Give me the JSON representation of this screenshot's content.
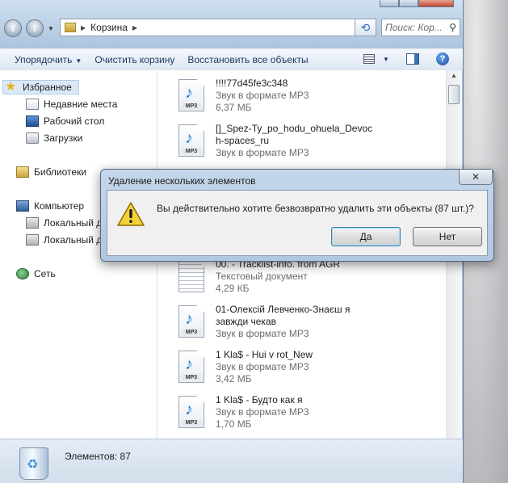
{
  "address": {
    "location": "Корзина",
    "search_placeholder": "Поиск: Кор..."
  },
  "toolbar": {
    "organize": "Упорядочить",
    "empty_bin": "Очистить корзину",
    "restore_all": "Восстановить все объекты"
  },
  "nav": {
    "favorites": "Избранное",
    "recent": "Недавние места",
    "desktop": "Рабочий стол",
    "downloads": "Загрузки",
    "libraries": "Библиотеки",
    "computer": "Компьютер",
    "local_disk_1": "Локальный д",
    "local_disk_2": "Локальный д",
    "network": "Сеть"
  },
  "files": [
    {
      "name": "!!!!77d45fe3c348",
      "type": "Звук в формате MP3",
      "size": "6,37 МБ",
      "icon": "mp3"
    },
    {
      "name": "[]_Spez-Ty_po_hodu_ohuela_Devoc",
      "name2": "h-spaces_ru",
      "type": "Звук в формате MP3",
      "icon": "mp3"
    },
    {
      "name": "00. - Tracklist-info. from AGR",
      "type": "Текстовый документ",
      "size": "4,29 КБ",
      "icon": "txt"
    },
    {
      "name": "01-Олексій Левченко-Знаєш я",
      "name2": "завжди чекав",
      "type": "Звук в формате MP3",
      "icon": "mp3"
    },
    {
      "name": "1 Kla$ - Hui v rot_New",
      "type": "Звук в формате MP3",
      "size": "3,42 МБ",
      "icon": "mp3"
    },
    {
      "name": "1 Kla$ - Будто как я",
      "type": "Звук в формате MP3",
      "size": "1,70 МБ",
      "icon": "mp3"
    }
  ],
  "status": {
    "items": "Элементов: 87"
  },
  "dialog": {
    "title": "Удаление нескольких элементов",
    "message": "Вы действительно хотите безвозвратно удалить эти объекты (87 шт.)?",
    "yes": "Да",
    "no": "Нет"
  },
  "icons": {
    "back": "arrow-left-icon",
    "forward": "arrow-right-icon",
    "refresh": "refresh-icon",
    "search": "search-icon",
    "help": "help-icon",
    "warning": "warning-icon",
    "close": "close-icon"
  }
}
